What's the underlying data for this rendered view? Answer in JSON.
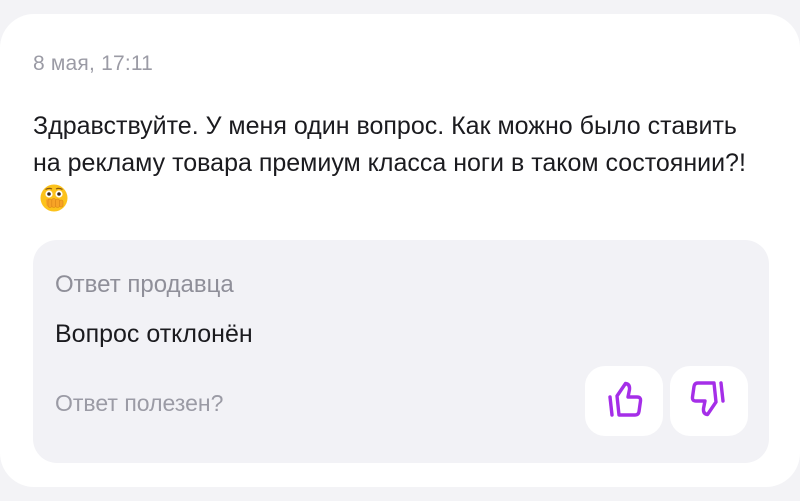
{
  "review": {
    "date": "8 мая, 17:11",
    "question": "Здравствуйте. У меня один вопрос. Как можно было ставить на рекламу товара премиум класса ноги в таком состоянии?!",
    "emoji_icon": "face-with-open-eyes-and-hand-over-mouth-icon"
  },
  "answer": {
    "title": "Ответ продавца",
    "text": "Вопрос отклонён",
    "helpful_label": "Ответ полезен?",
    "like_icon": "thumbs-up-icon",
    "dislike_icon": "thumbs-down-icon"
  },
  "colors": {
    "accent": "#a52ee8",
    "card_bg": "#ffffff",
    "answer_bg": "#f2f2f6",
    "page_bg": "#f3f3f6"
  }
}
